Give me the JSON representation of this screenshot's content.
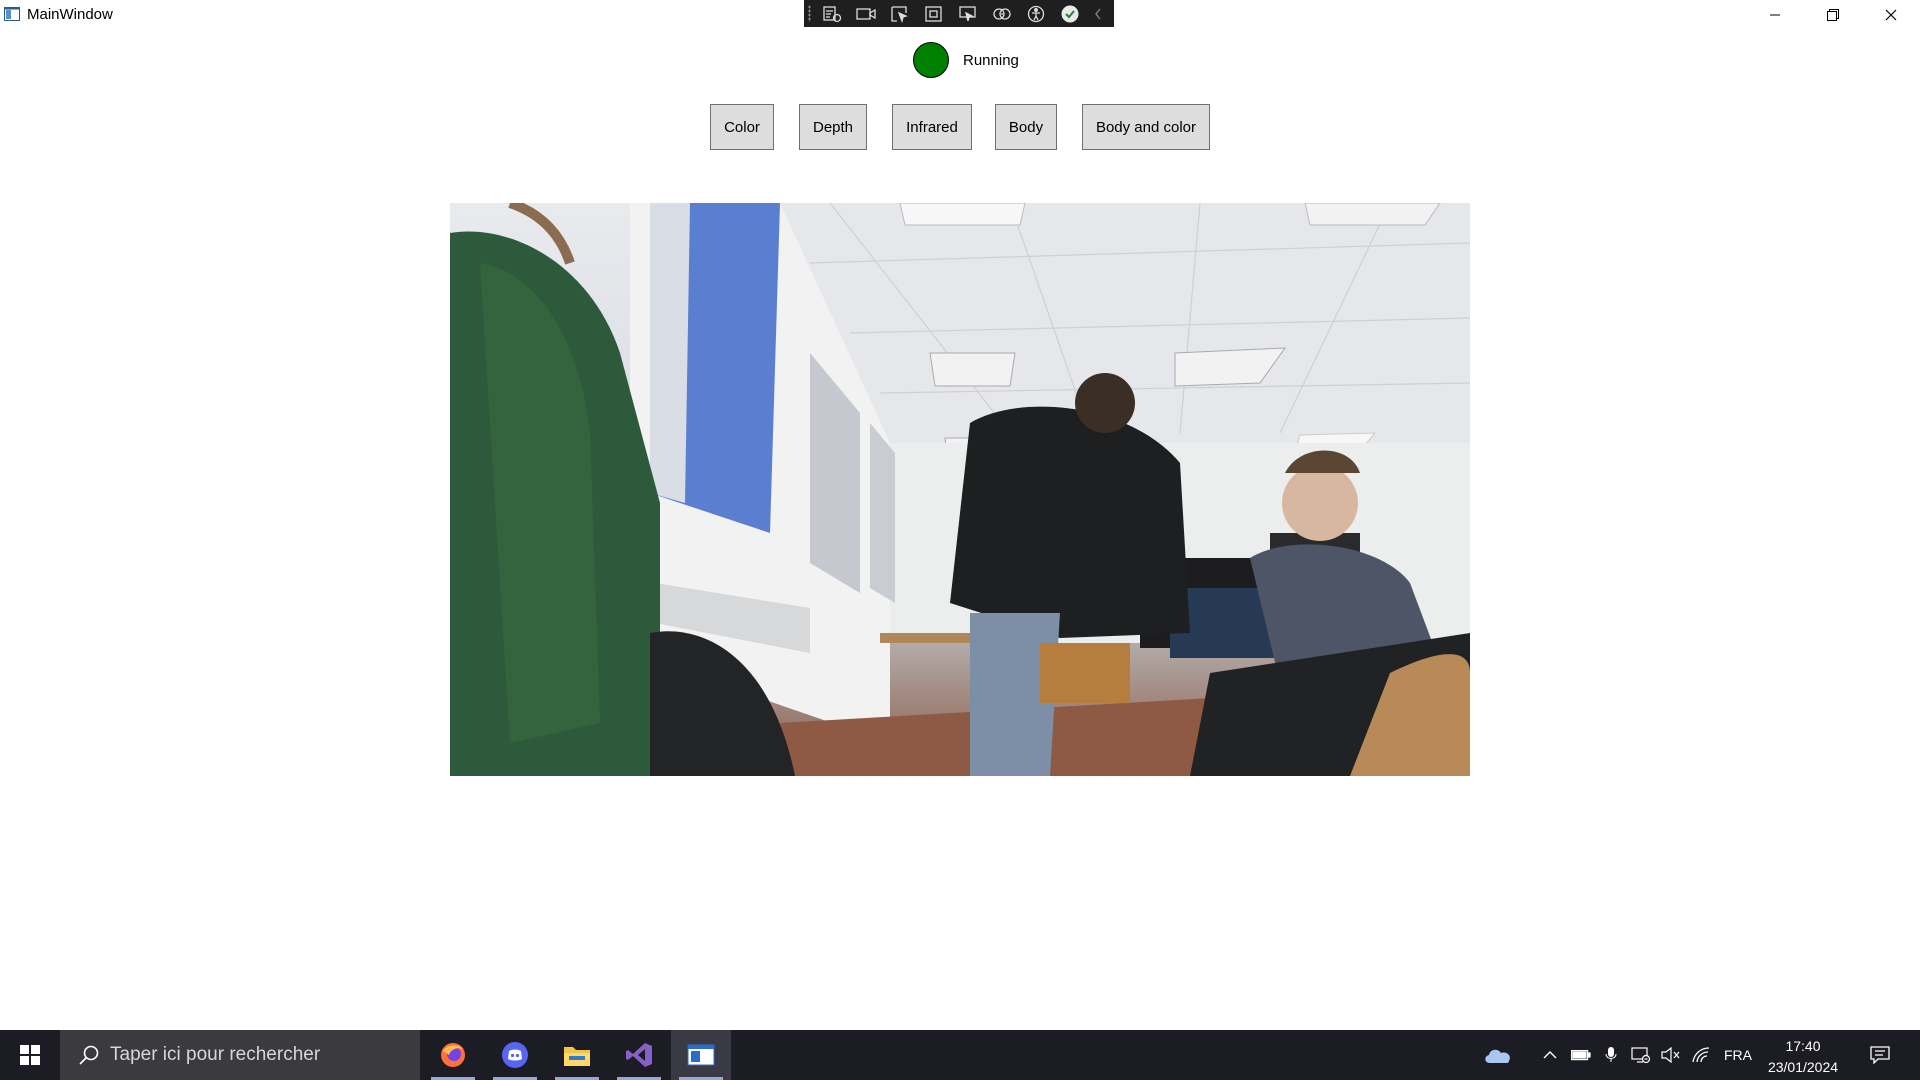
{
  "window": {
    "title": "MainWindow",
    "controls": [
      "minimize",
      "restore",
      "close"
    ]
  },
  "debug_toolbar": {
    "buttons": [
      "live-visual-tree-icon",
      "video-icon",
      "select-element-icon",
      "display-layout-adorners-icon",
      "track-focus-icon",
      "binding-failures-icon",
      "accessibility-icon",
      "hot-reload-ok-icon",
      "collapse-chevron-icon"
    ]
  },
  "status": {
    "label": "Running",
    "indicator_color": "#008000"
  },
  "modes": [
    {
      "label": "Color"
    },
    {
      "label": "Depth"
    },
    {
      "label": "Infrared"
    },
    {
      "label": "Body"
    },
    {
      "label": "Body and color"
    }
  ],
  "viewport": {
    "description_icon": "camera-feed-image"
  },
  "taskbar": {
    "search_placeholder": "Taper ici pour rechercher",
    "apps": [
      "firefox-icon",
      "discord-icon",
      "file-explorer-icon",
      "visual-studio-icon",
      "mainwindow-app-icon"
    ],
    "tray": {
      "language": "FRA",
      "time": "17:40",
      "date": "23/01/2024"
    }
  }
}
